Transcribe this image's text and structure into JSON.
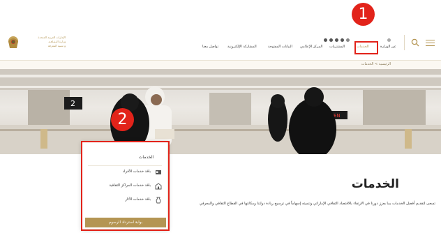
{
  "header": {
    "logo_lines": [
      "الإمارات العربية المتحدة",
      "وزارة الثـقـافـة",
      "و تنمية المعرفة"
    ],
    "nav": [
      {
        "label": "عن الوزارة"
      },
      {
        "label": "الخدمات",
        "active": true
      },
      {
        "label": "المشتريات"
      },
      {
        "label": "المركز الإعلامي"
      },
      {
        "label": "البيانات المفتوحة"
      },
      {
        "label": "المشاركة الإلكترونية"
      },
      {
        "label": "تواصل معنا"
      }
    ],
    "menu_icon": "hamburger-icon",
    "search_icon": "search-icon"
  },
  "breadcrumb": "الرئيسية > الخدمات",
  "hero": {
    "counter_left": "2",
    "counter_right_label": "EN"
  },
  "page": {
    "title": "الخدمات",
    "description": "تسعى لتقديم أفضل الخدمات بما يعزز دورنا في الارتقاء بالاقتصاد الثقافي الإماراتي وتنميته إسهاماً في ترسيخ ريادة دولتنا ومكانتها في القطاع الثقافي والمعرفي"
  },
  "dropdown": {
    "title": "الخدمات",
    "items": [
      {
        "label": "باقة خدمات الأفراد",
        "icon": "id-card-icon"
      },
      {
        "label": "باقة خدمات المراكز الثقافية",
        "icon": "building-icon"
      },
      {
        "label": "باقة خدمات الآثار",
        "icon": "pottery-icon"
      }
    ],
    "button_label": "بوابة استرداد الرسوم"
  },
  "annotations": [
    {
      "label": "1"
    },
    {
      "label": "2"
    }
  ],
  "colors": {
    "accent": "#b49553",
    "highlight": "#e2231a"
  }
}
